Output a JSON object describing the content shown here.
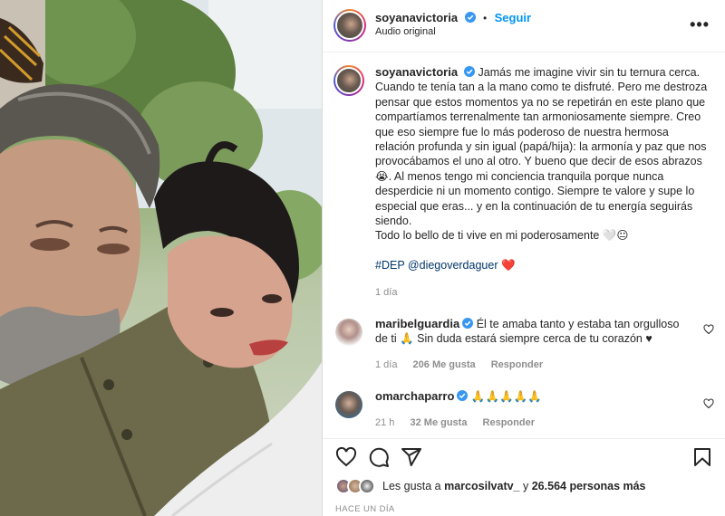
{
  "post": {
    "author": "soyanavictoria",
    "follow_label": "Seguir",
    "audio_label": "Audio original",
    "more_label": "•••"
  },
  "caption": {
    "author": "soyanavictoria",
    "line1": "Jamás me imagine vivir sin tu ternura cerca.",
    "body": "Cuando te tenía tan a la mano como te disfruté. Pero me destroza pensar que estos momentos ya no se repetirán en este plano que compartíamos terrenalmente tan armoniosamente siempre. Creo que eso siempre fue lo más poderoso de nuestra hermosa relación profunda y sin igual (papá/hija): la armonía y paz que nos provocábamos el uno al otro. Y bueno que decir de esos abrazos",
    "body_emoji": "😭",
    "body2": ". Al menos tengo mi conciencia tranquila porque nunca desperdicie ni un momento contigo. Siempre te valore y supe lo especial que eras... y en la continuación de tu energía seguirás siendo.",
    "line_last": "Todo lo bello de ti vive en mi poderosamente",
    "line_last_emoji": "🤍😐",
    "hashtag": "#DEP",
    "mention": "@diegoverdaguer",
    "tag_emoji": "❤️",
    "time": "1 día"
  },
  "comments": [
    {
      "author": "maribelguardia",
      "text": "Él te amaba tanto y estaba tan orgulloso de ti 🙏 Sin duda estará siempre cerca de tu corazón ♥",
      "time": "1 día",
      "likes": "206 Me gusta",
      "reply": "Responder"
    },
    {
      "author": "omarchaparro",
      "text": "🙏🙏🙏🙏🙏",
      "time": "21 h",
      "likes": "32 Me gusta",
      "reply": "Responder"
    }
  ],
  "likes": {
    "prefix": "Les gusta a",
    "user": "marcosilvatv_",
    "middle": "y",
    "count": "26.564 personas más"
  },
  "post_date": "HACE UN DÍA",
  "colors": {
    "accent": "#0095f6",
    "verified": "#3897f0",
    "like_heart": "#ed4956",
    "muted": "#8e8e8e"
  },
  "icons": [
    "heart-icon",
    "comment-icon",
    "share-icon",
    "bookmark-icon",
    "more-icon",
    "verified-icon"
  ]
}
